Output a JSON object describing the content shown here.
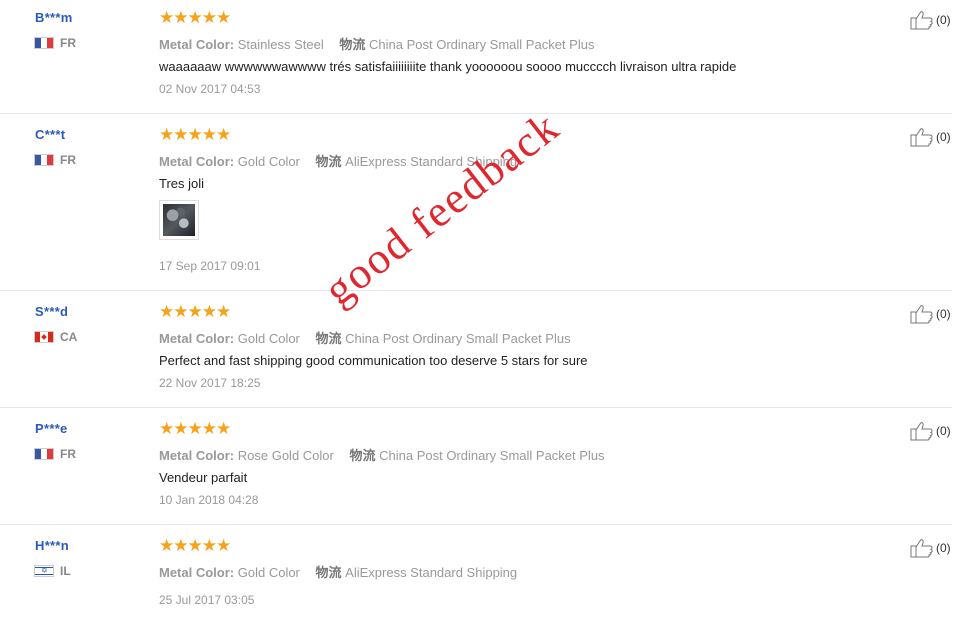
{
  "labels": {
    "color_label": "Metal Color:",
    "shipping_label": "物流"
  },
  "reviews": [
    {
      "user": "B***m",
      "country": "FR",
      "flag": "fr",
      "rating": 5,
      "stars": "★★★★★",
      "color": "Stainless Steel",
      "shipping": "China Post Ordinary Small Packet Plus",
      "text": "waaaaaaw wwwwwwawwww trés satisfaiiiiiiiite thank yoooooou soooo mucccch livraison ultra rapide",
      "date": "02 Nov 2017 04:53",
      "likes": "(0)"
    },
    {
      "user": "C***t",
      "country": "FR",
      "flag": "fr",
      "rating": 5,
      "stars": "★★★★★",
      "color": "Gold Color",
      "shipping": "AliExpress Standard Shipping",
      "text": "Tres joli",
      "has_photo": true,
      "date": "17 Sep 2017 09:01",
      "likes": "(0)"
    },
    {
      "user": "S***d",
      "country": "CA",
      "flag": "ca",
      "rating": 5,
      "stars": "★★★★★",
      "color": "Gold Color",
      "shipping": "China Post Ordinary Small Packet Plus",
      "text": "Perfect and fast shipping good communication too deserve 5 stars for sure",
      "date": "22 Nov 2017 18:25",
      "likes": "(0)"
    },
    {
      "user": "P***e",
      "country": "FR",
      "flag": "fr",
      "rating": 5,
      "stars": "★★★★★",
      "color": "Rose Gold Color",
      "shipping": "China Post Ordinary Small Packet Plus",
      "text": "Vendeur parfait",
      "date": "10 Jan 2018 04:28",
      "likes": "(0)"
    },
    {
      "user": "H***n",
      "country": "IL",
      "flag": "il",
      "rating": 5,
      "stars": "★★★★★",
      "color": "Gold Color",
      "shipping": "AliExpress Standard Shipping",
      "text": "",
      "date": "25 Jul 2017 03:05",
      "likes": "(0)"
    }
  ],
  "watermark": "good feedback",
  "colors": {
    "username": "#2a5bb8",
    "stars": "#f7a21b",
    "watermark": "#e0262e"
  }
}
